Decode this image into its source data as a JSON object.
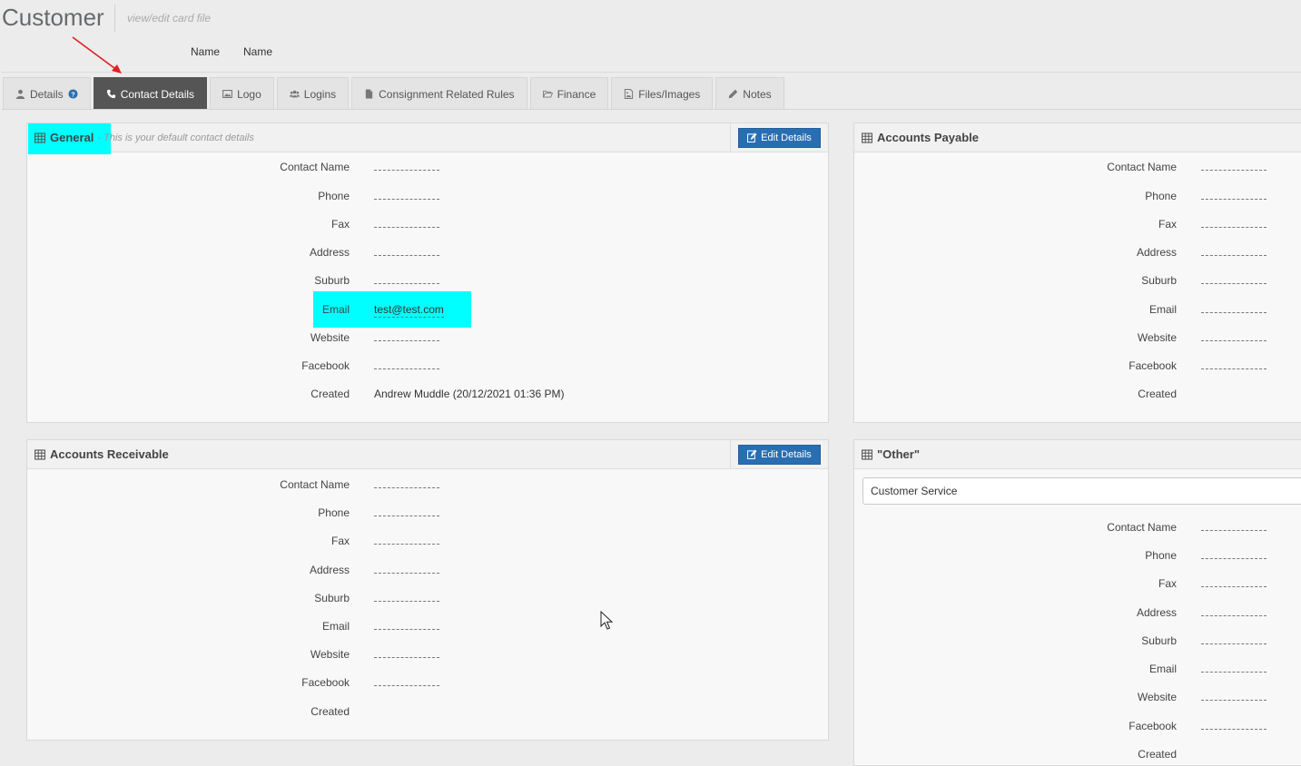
{
  "header": {
    "title": "Customer",
    "subtitle": "view/edit card file",
    "name_label_1": "Name",
    "name_label_2": "Name"
  },
  "tabs": [
    {
      "label": "Details",
      "icon": "user-icon",
      "active": false
    },
    {
      "label": "Contact Details",
      "icon": "phone-icon",
      "active": true
    },
    {
      "label": "Logo",
      "icon": "image-icon",
      "active": false
    },
    {
      "label": "Logins",
      "icon": "users-icon",
      "active": false
    },
    {
      "label": "Consignment Related Rules",
      "icon": "file-icon",
      "active": false
    },
    {
      "label": "Finance",
      "icon": "folder-open-icon",
      "active": false
    },
    {
      "label": "Files/Images",
      "icon": "file-image-icon",
      "active": false
    },
    {
      "label": "Notes",
      "icon": "pencil-icon",
      "active": false
    }
  ],
  "panels": {
    "general": {
      "title": "General",
      "hint": "- This is your default contact details",
      "edit_label": "Edit Details",
      "fields": [
        {
          "label": "Contact Name",
          "value": ""
        },
        {
          "label": "Phone",
          "value": ""
        },
        {
          "label": "Fax",
          "value": ""
        },
        {
          "label": "Address",
          "value": ""
        },
        {
          "label": "Suburb",
          "value": ""
        },
        {
          "label": "Email",
          "value": "test@test.com"
        },
        {
          "label": "Website",
          "value": ""
        },
        {
          "label": "Facebook",
          "value": ""
        },
        {
          "label": "Created",
          "value": "Andrew Muddle (20/12/2021 01:36 PM)"
        }
      ]
    },
    "accounts_payable": {
      "title": "Accounts Payable",
      "fields": [
        {
          "label": "Contact Name",
          "value": ""
        },
        {
          "label": "Phone",
          "value": ""
        },
        {
          "label": "Fax",
          "value": ""
        },
        {
          "label": "Address",
          "value": ""
        },
        {
          "label": "Suburb",
          "value": ""
        },
        {
          "label": "Email",
          "value": ""
        },
        {
          "label": "Website",
          "value": ""
        },
        {
          "label": "Facebook",
          "value": ""
        },
        {
          "label": "Created",
          "value": ""
        }
      ]
    },
    "accounts_receivable": {
      "title": "Accounts Receivable",
      "edit_label": "Edit Details",
      "fields": [
        {
          "label": "Contact Name",
          "value": ""
        },
        {
          "label": "Phone",
          "value": ""
        },
        {
          "label": "Fax",
          "value": ""
        },
        {
          "label": "Address",
          "value": ""
        },
        {
          "label": "Suburb",
          "value": ""
        },
        {
          "label": "Email",
          "value": ""
        },
        {
          "label": "Website",
          "value": ""
        },
        {
          "label": "Facebook",
          "value": ""
        },
        {
          "label": "Created",
          "value": ""
        }
      ]
    },
    "other": {
      "title": "\"Other\"",
      "select_value": "Customer Service",
      "fields": [
        {
          "label": "Contact Name",
          "value": ""
        },
        {
          "label": "Phone",
          "value": ""
        },
        {
          "label": "Fax",
          "value": ""
        },
        {
          "label": "Address",
          "value": ""
        },
        {
          "label": "Suburb",
          "value": ""
        },
        {
          "label": "Email",
          "value": ""
        },
        {
          "label": "Website",
          "value": ""
        },
        {
          "label": "Facebook",
          "value": ""
        },
        {
          "label": "Created",
          "value": ""
        }
      ]
    }
  },
  "colors": {
    "active_tab": "#555555",
    "button": "#2a6eb2",
    "highlight": "#00ffff",
    "annotation_arrow": "#e02020"
  }
}
